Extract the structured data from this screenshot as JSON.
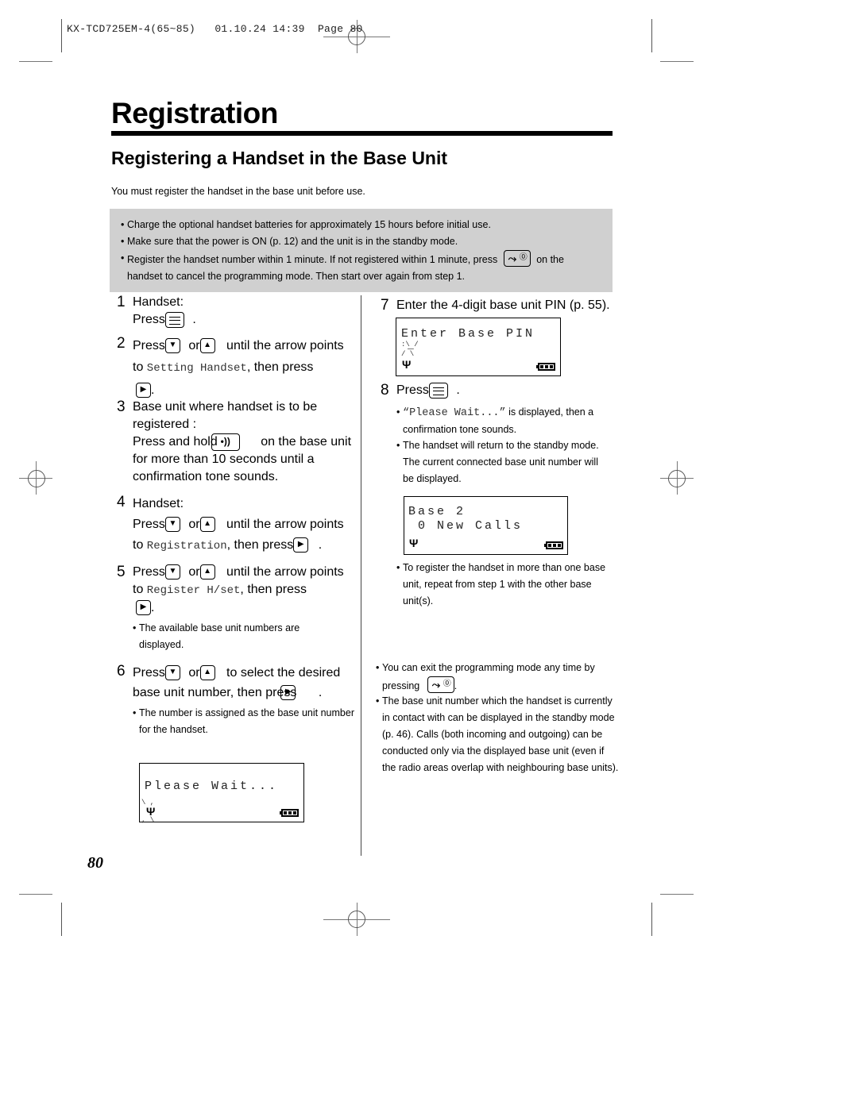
{
  "header": {
    "slug": "KX-TCD725EM-4(65~85)   01.10.24 14:39  Page 80"
  },
  "page_title": "Registration",
  "section_title": "Registering a Handset in the Base Unit",
  "intro": "You must register the handset in the base unit before use.",
  "notice": {
    "items": [
      "Charge the optional handset batteries for approximately 15 hours before initial use.",
      "Make sure that the power is ON (p. 12) and the unit is in the standby mode.",
      "Register the handset number within 1 minute. If not registered within 1 minute, press",
      "on the",
      "handset to cancel the programming mode. Then start over again from step 1."
    ]
  },
  "steps": {
    "s1": {
      "num": "1",
      "line1": "Handset:",
      "press": "Press",
      "end": "."
    },
    "s2": {
      "num": "2",
      "press": "Press",
      "or": "or",
      "until": "until the arrow points",
      "to": "to",
      "target": "Setting Handset",
      "then": ", then press",
      "end": "."
    },
    "s3": {
      "num": "3",
      "line1": "Base unit where handset is to be",
      "line2": "registered :",
      "press_hold": "Press and hold",
      "on_base": "on the base unit",
      "line4": "for more than 10 seconds until a",
      "line5": "confirmation tone sounds."
    },
    "s4": {
      "num": "4",
      "line1": "Handset:",
      "press": "Press",
      "or": "or",
      "until": "until the arrow points",
      "to": "to",
      "target": "Registration",
      "then": ", then press",
      "end": "."
    },
    "s5": {
      "num": "5",
      "press": "Press",
      "or": "or",
      "until": "until the arrow points",
      "to": "to",
      "target": "Register H/set",
      "then": ", then press",
      "end": ".",
      "note": "The available base unit numbers are displayed."
    },
    "s6": {
      "num": "6",
      "press": "Press",
      "or": "or",
      "until": "to select the desired",
      "line2": "base unit number, then press",
      "end": ".",
      "note": "The number is assigned as the base unit number for the handset."
    },
    "s7": {
      "num": "7",
      "text": "Enter the 4-digit base unit PIN (p. 55)."
    },
    "s8": {
      "num": "8",
      "press": "Press",
      "end": ".",
      "note1_mono": "“Please Wait...”",
      "note1": " is displayed, then a confirmation tone sounds.",
      "note2": "The handset will return to the standby mode. The current connected base unit number will be displayed.",
      "note3": "To register the handset in more than one base unit, repeat from step 1 with the other base unit(s)."
    }
  },
  "displays": {
    "please_wait": {
      "line1": "Please Wait..."
    },
    "enter_pin": {
      "line1": "Enter Base PIN",
      "cursor": "_"
    },
    "base2": {
      "line1": "Base 2",
      "line2": " 0 New Calls"
    }
  },
  "buttons": {
    "down_arrow": "▼",
    "up_arrow": "▲",
    "right_arrow": "▶",
    "page_symbol": "•))"
  },
  "tips": {
    "exit": "You can exit the programming mode any time by pressing",
    "exit_end": ".",
    "base_info": "The base unit number which the handset is currently in contact with can be displayed in the standby mode (p. 46). Calls (both incoming and outgoing) can be conducted only via the displayed base unit (even if the radio areas overlap with neighbouring base units)."
  },
  "page_number": "80"
}
